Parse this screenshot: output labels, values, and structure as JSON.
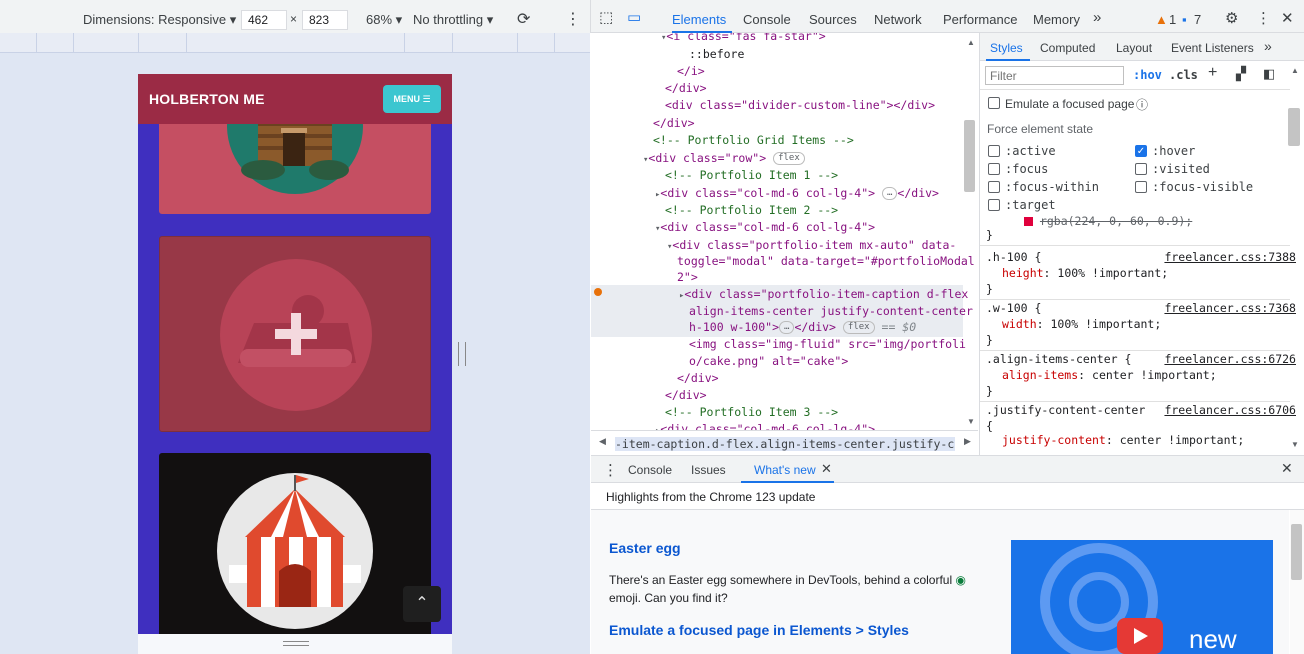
{
  "device_toolbar": {
    "dimensions_label": "Dimensions: Responsive",
    "width": "462",
    "times": "×",
    "height": "823",
    "zoom": "68%",
    "throttling": "No throttling"
  },
  "phone": {
    "brand": "HOLBERTON ME",
    "menu_label": "MENU ☰",
    "scroll_top": "⌃",
    "colors": {
      "nav": "#9b2b45",
      "bg": "#3f2fbf",
      "menu": "#3cc6d0"
    }
  },
  "devtools": {
    "tabs": [
      "Elements",
      "Console",
      "Sources",
      "Network",
      "Performance",
      "Memory"
    ],
    "more": "»",
    "warnings": "1",
    "messages": "7"
  },
  "elements": {
    "lines": [
      {
        "i": 0,
        "html": "<i class=\"fas fa-star\">"
      },
      {
        "i": 1,
        "html": "::before"
      },
      {
        "i": 2,
        "html": "</i>"
      },
      {
        "i": 3,
        "html": "</div>"
      },
      {
        "i": 4,
        "html": "<div class=\"divider-custom-line\"></div>"
      },
      {
        "i": 5,
        "html": "</div>"
      },
      {
        "i": 6,
        "html": "<!-- Portfolio Grid Items -->"
      },
      {
        "i": 7,
        "html": "<div class=\"row\">"
      },
      {
        "i": 8,
        "html": "<!-- Portfolio Item 1 -->"
      },
      {
        "i": 9,
        "html": "<div class=\"col-md-6 col-lg-4\">"
      },
      {
        "i": 10,
        "html": "<!-- Portfolio Item 2 -->"
      },
      {
        "i": 11,
        "html": "<div class=\"col-md-6 col-lg-4\">"
      },
      {
        "i": 12,
        "html": "<div class=\"portfolio-item mx-auto\" data-"
      },
      {
        "i": 13,
        "html": "toggle=\"modal\" data-target=\"#portfolioModal"
      },
      {
        "i": 14,
        "html": "2\">"
      },
      {
        "i": 15,
        "html": "<div class=\"portfolio-item-caption d-flex"
      },
      {
        "i": 16,
        "html": "align-items-center justify-content-center"
      },
      {
        "i": 17,
        "html": "h-100 w-100\">"
      },
      {
        "i": 18,
        "html": "<img class=\"img-fluid\" src=\"img/portfoli"
      },
      {
        "i": 19,
        "html": "o/cake.png\" alt=\"cake\">"
      },
      {
        "i": 20,
        "html": "</div>"
      },
      {
        "i": 21,
        "html": "</div>"
      },
      {
        "i": 22,
        "html": "<!-- Portfolio Item 3 -->"
      },
      {
        "i": 23,
        "html": "<div class=\"col-md-6 col-lg-4\">"
      }
    ],
    "flex_badge": "flex",
    "ellipsis": "…",
    "eq": "== $0",
    "breadcrumb": "-item-caption.d-flex.align-items-center.justify-content-center.h-"
  },
  "styles": {
    "tabs": [
      "Styles",
      "Computed",
      "Layout",
      "Event Listeners"
    ],
    "more": "»",
    "filter_placeholder": "Filter",
    "hov": ":hov",
    "cls": ".cls",
    "emulate": "Emulate a focused page",
    "force_state": "Force element state",
    "states_left": [
      ":active",
      ":focus",
      ":focus-within",
      ":target"
    ],
    "states_right": [
      ":hover",
      ":visited",
      ":focus-visible"
    ],
    "hover_checked": true,
    "struck": "rgba(224, 0, 60, 0.9);",
    "rules": [
      {
        "selector": ".h-100 {",
        "source": "freelancer.css:7388",
        "prop": "height",
        "value": "100% !important;"
      },
      {
        "selector": ".w-100 {",
        "source": "freelancer.css:7368",
        "prop": "width",
        "value": "100% !important;"
      },
      {
        "selector": ".align-items-center {",
        "source": "freelancer.css:6726",
        "prop": "align-items",
        "value": "center !important;"
      },
      {
        "selector": ".justify-content-center",
        "source": "freelancer.css:6706",
        "prop": "justify-content",
        "value": "center !important;"
      }
    ],
    "close_brace": "}",
    "open_brace": "{"
  },
  "drawer": {
    "tabs": [
      "Console",
      "Issues",
      "What's new"
    ],
    "header": "Highlights from the Chrome 123 update",
    "h1": "Easter egg",
    "p1a": "There's an Easter egg somewhere in DevTools, behind a colorful",
    "p1b": "emoji. Can you find it?",
    "h2": "Emulate a focused page in Elements > Styles",
    "promo_text": "new"
  }
}
